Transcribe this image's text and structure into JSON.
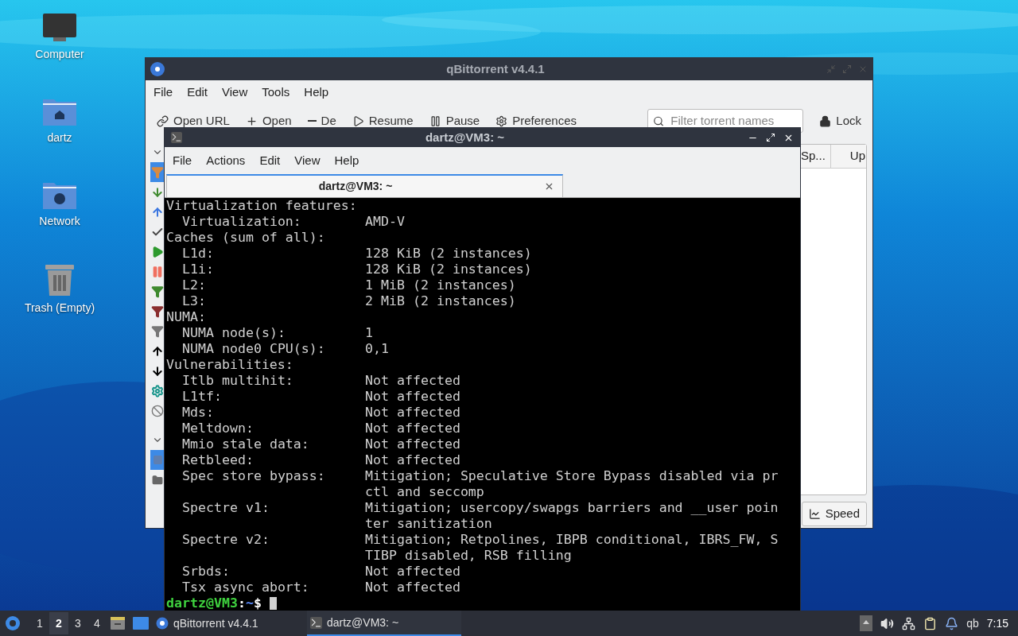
{
  "desktop_icons": [
    {
      "kind": "computer",
      "label": "Computer"
    },
    {
      "kind": "home",
      "label": "dartz"
    },
    {
      "kind": "network",
      "label": "Network"
    },
    {
      "kind": "trash",
      "label": "Trash (Empty)"
    }
  ],
  "qbittorrent": {
    "title": "qBittorrent v4.4.1",
    "menu": [
      "File",
      "Edit",
      "View",
      "Tools",
      "Help"
    ],
    "toolbar": [
      {
        "kind": "link",
        "label": "Open URL"
      },
      {
        "kind": "add",
        "label": "Open"
      },
      {
        "kind": "remove",
        "label": "De"
      },
      {
        "kind": "play",
        "label": "Resume"
      },
      {
        "kind": "pause",
        "label": "Pause"
      },
      {
        "kind": "gear",
        "label": "Preferences"
      }
    ],
    "search": {
      "placeholder": "Filter torrent names"
    },
    "lock": "Lock",
    "status_filters": [
      {
        "kind": "all",
        "selected": true
      },
      {
        "kind": "downloading",
        "selected": false
      },
      {
        "kind": "seeding",
        "selected": false
      },
      {
        "kind": "completed",
        "selected": false
      },
      {
        "kind": "resumed",
        "selected": false
      },
      {
        "kind": "paused",
        "selected": false
      },
      {
        "kind": "active",
        "selected": false
      },
      {
        "kind": "inactive",
        "selected": false
      },
      {
        "kind": "stalled",
        "selected": false
      },
      {
        "kind": "stalled_up",
        "selected": false
      },
      {
        "kind": "stalled_down",
        "selected": false
      },
      {
        "kind": "checking",
        "selected": false
      },
      {
        "kind": "errored",
        "selected": false
      }
    ],
    "categories": [
      {
        "kind": "all",
        "selected": true
      },
      {
        "kind": "folder",
        "selected": false
      }
    ],
    "columns": [
      "Sp...",
      "Up"
    ],
    "speed_button": "Speed"
  },
  "terminal": {
    "title": "dartz@VM3: ~",
    "menu": [
      "File",
      "Actions",
      "Edit",
      "View",
      "Help"
    ],
    "tab": "dartz@VM3: ~",
    "lines": [
      {
        "kind": "heading",
        "label": "Virtualization features:"
      },
      {
        "kind": "entry",
        "label": "Virtualization:",
        "value": "AMD-V"
      },
      {
        "kind": "heading",
        "label": "Caches (sum of all):"
      },
      {
        "kind": "entry",
        "label": "L1d:",
        "value": "128 KiB (2 instances)"
      },
      {
        "kind": "entry",
        "label": "L1i:",
        "value": "128 KiB (2 instances)"
      },
      {
        "kind": "entry",
        "label": "L2:",
        "value": "1 MiB (2 instances)"
      },
      {
        "kind": "entry",
        "label": "L3:",
        "value": "2 MiB (2 instances)"
      },
      {
        "kind": "heading",
        "label": "NUMA:"
      },
      {
        "kind": "entry",
        "label": "NUMA node(s):",
        "value": "1"
      },
      {
        "kind": "entry",
        "label": "NUMA node0 CPU(s):",
        "value": "0,1"
      },
      {
        "kind": "heading",
        "label": "Vulnerabilities:"
      },
      {
        "kind": "entry",
        "label": "Itlb multihit:",
        "value": "Not affected"
      },
      {
        "kind": "entry",
        "label": "L1tf:",
        "value": "Not affected"
      },
      {
        "kind": "entry",
        "label": "Mds:",
        "value": "Not affected"
      },
      {
        "kind": "entry",
        "label": "Meltdown:",
        "value": "Not affected"
      },
      {
        "kind": "entry",
        "label": "Mmio stale data:",
        "value": "Not affected"
      },
      {
        "kind": "entry",
        "label": "Retbleed:",
        "value": "Not affected"
      },
      {
        "kind": "entry",
        "label": "Spec store bypass:",
        "value": "Mitigation; Speculative Store Bypass disabled via pr"
      },
      {
        "kind": "continuation",
        "value": "ctl and seccomp"
      },
      {
        "kind": "entry",
        "label": "Spectre v1:",
        "value": "Mitigation; usercopy/swapgs barriers and __user poin"
      },
      {
        "kind": "continuation",
        "value": "ter sanitization"
      },
      {
        "kind": "entry",
        "label": "Spectre v2:",
        "value": "Mitigation; Retpolines, IBPB conditional, IBRS_FW, S"
      },
      {
        "kind": "continuation",
        "value": "TIBP disabled, RSB filling"
      },
      {
        "kind": "entry",
        "label": "Srbds:",
        "value": "Not affected"
      },
      {
        "kind": "entry",
        "label": "Tsx async abort:",
        "value": "Not affected"
      }
    ],
    "prompt": {
      "user_host": "dartz@VM3",
      "separator": ":",
      "path": "~",
      "symbol": "$"
    }
  },
  "taskbar": {
    "workspaces": [
      {
        "label": "1",
        "selected": false
      },
      {
        "label": "2",
        "selected": true
      },
      {
        "label": "3",
        "selected": false
      },
      {
        "label": "4",
        "selected": false
      }
    ],
    "tasks": [
      {
        "kind": "qbittorrent",
        "label": "qBittorrent v4.4.1",
        "selected": false
      },
      {
        "kind": "terminal",
        "label": "dartz@VM3: ~",
        "selected": true
      }
    ],
    "tray_label": "qb",
    "clock": "7:15"
  }
}
